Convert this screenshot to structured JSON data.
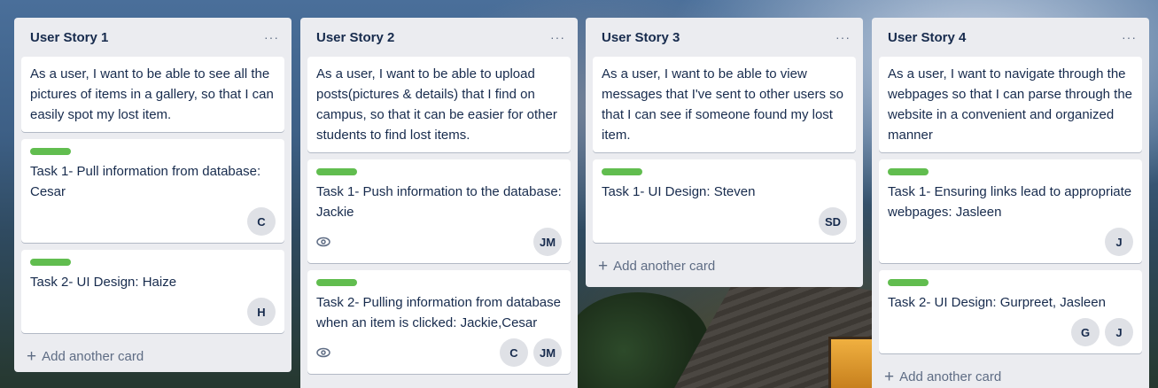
{
  "lists": [
    {
      "title": "User Story 1",
      "menu": "···",
      "story": "As a user, I want to be able to see all the pictures of items in a gallery, so that I can easily spot my lost item.",
      "tasks": [
        {
          "text": "Task 1- Pull information from database: Cesar",
          "members": [
            "C"
          ]
        },
        {
          "text": "Task 2- UI Design: Haize",
          "members": [
            "H"
          ]
        }
      ],
      "add_card": "Add another card"
    },
    {
      "title": "User Story 2",
      "menu": "···",
      "story": "As a user, I want to be able to upload posts(pictures & details) that I find on campus, so that it can be easier for other students to find lost items.",
      "tasks": [
        {
          "text": "Task 1- Push information to the database: Jackie",
          "members": [
            "JM"
          ],
          "watch": true
        },
        {
          "text": "Task 2- Pulling information from database when an item is clicked: Jackie,Cesar",
          "members": [
            "C",
            "JM"
          ],
          "watch": true
        }
      ]
    },
    {
      "title": "User Story 3",
      "menu": "···",
      "story": "As a user, I want to be able to view messages that I've sent to other users so that I can see if someone found my lost item.",
      "tasks": [
        {
          "text": "Task 1- UI Design: Steven",
          "members": [
            "SD"
          ]
        }
      ],
      "add_card": "Add another card"
    },
    {
      "title": "User Story 4",
      "menu": "···",
      "story": "As a user, I want to navigate through the webpages so that I can parse through the website in a convenient and organized manner",
      "tasks": [
        {
          "text": "Task 1- Ensuring links lead to appropriate webpages: Jasleen",
          "members": [
            "J"
          ]
        },
        {
          "text": "Task 2- UI Design: Gurpreet, Jasleen",
          "members": [
            "G",
            "J"
          ]
        }
      ],
      "add_card": "Add another card"
    }
  ],
  "colors": {
    "label_green": "#61bd4f",
    "list_bg": "#ebecf0"
  },
  "icons": {
    "watch": "eye-icon",
    "add": "plus-icon",
    "menu": "ellipsis-icon"
  }
}
